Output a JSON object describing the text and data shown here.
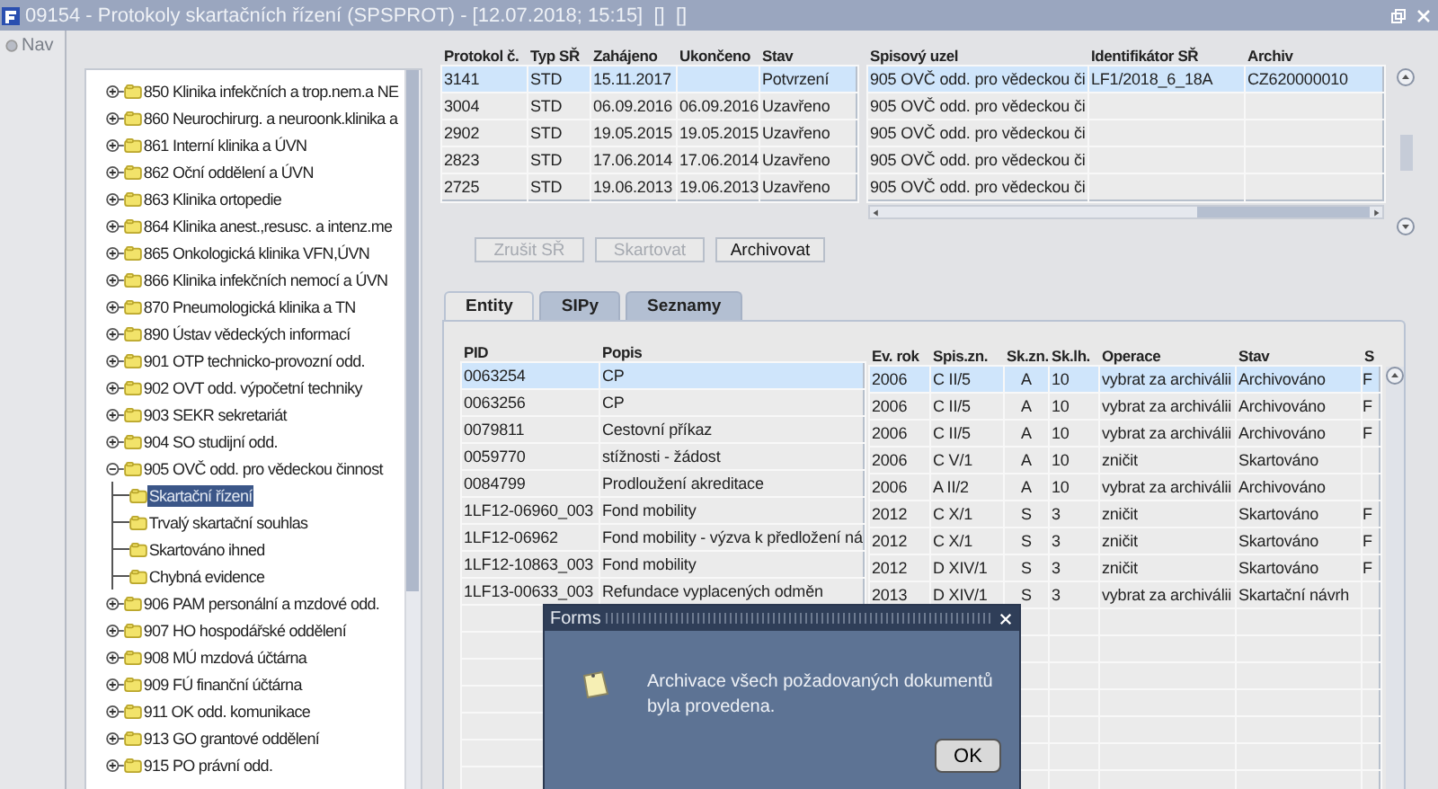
{
  "window": {
    "title": "09154 - Protokoly skartačních řízení (SPSPROT) - [12.07.2018; 15:15]  []  []"
  },
  "nav": {
    "label": "Nav"
  },
  "tree": {
    "items": [
      {
        "label": "850 Klinika infekčních a trop.nem.a NE",
        "expanded": false,
        "selected": false
      },
      {
        "label": "860 Neurochirurg. a neuroonk.klinika a",
        "expanded": false,
        "selected": false
      },
      {
        "label": "861 Interní klinika a ÚVN",
        "expanded": false,
        "selected": false
      },
      {
        "label": "862 Oční oddělení a ÚVN",
        "expanded": false,
        "selected": false
      },
      {
        "label": "863 Klinika ortopedie",
        "expanded": false,
        "selected": false
      },
      {
        "label": "864 Klinika anest.,resusc. a intenz.me",
        "expanded": false,
        "selected": false
      },
      {
        "label": "865 Onkologická klinika VFN,ÚVN",
        "expanded": false,
        "selected": false
      },
      {
        "label": "866 Klinika infekčních nemocí a ÚVN",
        "expanded": false,
        "selected": false
      },
      {
        "label": "870 Pneumologická klinika a TN",
        "expanded": false,
        "selected": false
      },
      {
        "label": "890 Ústav vědeckých informací",
        "expanded": false,
        "selected": false
      },
      {
        "label": "901 OTP technicko-provozní odd.",
        "expanded": false,
        "selected": false
      },
      {
        "label": "902 OVT odd. výpočetní techniky",
        "expanded": false,
        "selected": false
      },
      {
        "label": "903 SEKR sekretariát",
        "expanded": false,
        "selected": false
      },
      {
        "label": "904 SO studijní odd.",
        "expanded": false,
        "selected": false
      },
      {
        "label": "905 OVČ odd. pro vědeckou činnost",
        "expanded": true,
        "selected": false,
        "children": [
          {
            "label": "Skartační řízení",
            "selected": true
          },
          {
            "label": "Trvalý skartační souhlas",
            "selected": false
          },
          {
            "label": "Skartováno ihned",
            "selected": false
          },
          {
            "label": "Chybná evidence",
            "selected": false
          }
        ]
      },
      {
        "label": "906 PAM personální a mzdové odd.",
        "expanded": false,
        "selected": false
      },
      {
        "label": "907 HO hospodářské oddělení",
        "expanded": false,
        "selected": false
      },
      {
        "label": "908 MÚ mzdová účtárna",
        "expanded": false,
        "selected": false
      },
      {
        "label": "909 FÚ finanční účtárna",
        "expanded": false,
        "selected": false
      },
      {
        "label": "911 OK odd. komunikace",
        "expanded": false,
        "selected": false
      },
      {
        "label": "913 GO grantové oddělení",
        "expanded": false,
        "selected": false
      },
      {
        "label": "915 PO právní odd.",
        "expanded": false,
        "selected": false
      }
    ]
  },
  "protocols": {
    "columns": [
      "Protokol č.",
      "Typ SŘ",
      "Zahájeno",
      "Ukončeno",
      "Stav"
    ],
    "rows": [
      {
        "cells": [
          "3141",
          "STD",
          "15.11.2017",
          "",
          "Potvrzení"
        ],
        "selected": true
      },
      {
        "cells": [
          "3004",
          "STD",
          "06.09.2016",
          "06.09.2016",
          "Uzavřeno"
        ],
        "selected": false
      },
      {
        "cells": [
          "2902",
          "STD",
          "19.05.2015",
          "19.05.2015",
          "Uzavřeno"
        ],
        "selected": false
      },
      {
        "cells": [
          "2823",
          "STD",
          "17.06.2014",
          "17.06.2014",
          "Uzavřeno"
        ],
        "selected": false
      },
      {
        "cells": [
          "2725",
          "STD",
          "19.06.2013",
          "19.06.2013",
          "Uzavřeno"
        ],
        "selected": false
      }
    ]
  },
  "details": {
    "columns": [
      "Spisový uzel",
      "Identifikátor SŘ",
      "Archiv"
    ],
    "rows": [
      {
        "cells": [
          "905 OVČ odd. pro vědeckou či",
          "LF1/2018_6_18A",
          "CZ620000010"
        ],
        "selected": true
      },
      {
        "cells": [
          "905 OVČ odd. pro vědeckou či",
          "",
          ""
        ],
        "selected": false
      },
      {
        "cells": [
          "905 OVČ odd. pro vědeckou či",
          "",
          ""
        ],
        "selected": false
      },
      {
        "cells": [
          "905 OVČ odd. pro vědeckou či",
          "",
          ""
        ],
        "selected": false
      },
      {
        "cells": [
          "905 OVČ odd. pro vědeckou či",
          "",
          ""
        ],
        "selected": false
      }
    ]
  },
  "buttons": [
    {
      "label": "Zrušit SŘ",
      "disabled": true
    },
    {
      "label": "Skartovat",
      "disabled": true
    },
    {
      "label": "Archivovat",
      "disabled": false
    }
  ],
  "tabs": [
    {
      "label": "Entity",
      "selected": true
    },
    {
      "label": "SIPy",
      "selected": false
    },
    {
      "label": "Seznamy",
      "selected": false
    }
  ],
  "entities": {
    "columns": [
      "PID",
      "Popis"
    ],
    "rows": [
      {
        "cells": [
          "0063254",
          "CP"
        ],
        "selected": true
      },
      {
        "cells": [
          "0063256",
          "CP"
        ],
        "selected": false
      },
      {
        "cells": [
          "0079811",
          "Cestovní příkaz"
        ],
        "selected": false
      },
      {
        "cells": [
          "0059770",
          "stížnosti - žádost"
        ],
        "selected": false
      },
      {
        "cells": [
          "0084799",
          "Prodloužení akreditace"
        ],
        "selected": false
      },
      {
        "cells": [
          "1LF12-06960_003",
          "Fond mobility"
        ],
        "selected": false
      },
      {
        "cells": [
          "1LF12-06962",
          "Fond mobility - výzva k předložení ná"
        ],
        "selected": false
      },
      {
        "cells": [
          "1LF12-10863_003",
          "Fond mobility"
        ],
        "selected": false
      },
      {
        "cells": [
          "1LF13-00633_003",
          "Refundace vyplacených odměn"
        ],
        "selected": false
      }
    ]
  },
  "records": {
    "columns": [
      "Ev. rok",
      "Spis.zn.",
      "Sk.zn.",
      "Sk.lh.",
      "Operace",
      "Stav",
      "S"
    ],
    "rows": [
      {
        "cells": [
          "2006",
          "C II/5",
          "A",
          "10",
          "vybrat za archiválii",
          "Archivováno",
          "F"
        ],
        "selected": true
      },
      {
        "cells": [
          "2006",
          "C II/5",
          "A",
          "10",
          "vybrat za archiválii",
          "Archivováno",
          "F"
        ],
        "selected": false
      },
      {
        "cells": [
          "2006",
          "C II/5",
          "A",
          "10",
          "vybrat za archiválii",
          "Archivováno",
          "F"
        ],
        "selected": false
      },
      {
        "cells": [
          "2006",
          "C V/1",
          "A",
          "10",
          "zničit",
          "Skartováno",
          ""
        ],
        "selected": false
      },
      {
        "cells": [
          "2006",
          "A II/2",
          "A",
          "10",
          "vybrat za archiválii",
          "Archivováno",
          ""
        ],
        "selected": false
      },
      {
        "cells": [
          "2012",
          "C X/1",
          "S",
          "3",
          "zničit",
          "Skartováno",
          "F"
        ],
        "selected": false
      },
      {
        "cells": [
          "2012",
          "C X/1",
          "S",
          "3",
          "zničit",
          "Skartováno",
          "F"
        ],
        "selected": false
      },
      {
        "cells": [
          "2012",
          "D XIV/1",
          "S",
          "3",
          "zničit",
          "Skartováno",
          "F"
        ],
        "selected": false
      },
      {
        "cells": [
          "2013",
          "D XIV/1",
          "S",
          "3",
          "vybrat za archiválii",
          "Skartační návrh",
          ""
        ],
        "selected": false
      }
    ]
  },
  "dialog": {
    "title": "Forms",
    "message": "Archivace všech požadovaných dokumentů byla provedena.",
    "button": "OK"
  }
}
